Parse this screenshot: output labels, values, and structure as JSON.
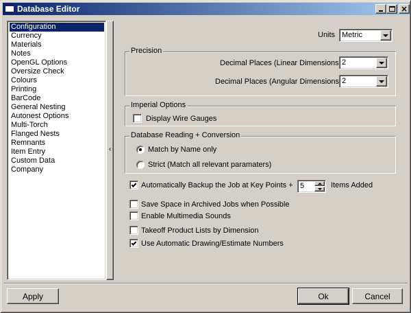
{
  "window": {
    "title": "Database Editor"
  },
  "nav": {
    "selected_index": 0,
    "items": [
      "Configuration",
      "Currency",
      "Materials",
      "Notes",
      "OpenGL Options",
      "Oversize Check",
      "Colours",
      "Printing",
      "BarCode",
      "General Nesting",
      "Autonest Options",
      "Multi-Torch",
      "Flanged Nests",
      "Remnants",
      "Item Entry",
      "Custom Data",
      "Company"
    ]
  },
  "units": {
    "label": "Units",
    "value": "Metric"
  },
  "precision": {
    "title": "Precision",
    "linear_label": "Decimal Places (Linear Dimensions)",
    "linear_value": "2",
    "angular_label": "Decimal Places (Angular Dimensions)",
    "angular_value": "2"
  },
  "imperial": {
    "title": "Imperial Options",
    "wire_gauges_label": "Display Wire Gauges",
    "wire_gauges_checked": false
  },
  "reading": {
    "title": "Database Reading + Conversion",
    "match_name_label": "Match by Name only",
    "strict_label": "Strict (Match all relevant paramaters)",
    "selected": "match_name"
  },
  "backup": {
    "label": "Automatically Backup the Job at Key Points +",
    "checked": true,
    "count": "5",
    "suffix": "Items Added"
  },
  "options": [
    {
      "label": "Save Space in Archived Jobs when Possible",
      "checked": false
    },
    {
      "label": "Enable Multimedia Sounds",
      "checked": false
    },
    {
      "label": "Takeoff Product Lists by Dimension",
      "checked": false
    },
    {
      "label": "Use Automatic Drawing/Estimate Numbers",
      "checked": true
    }
  ],
  "buttons": {
    "apply": "Apply",
    "ok": "Ok",
    "cancel": "Cancel"
  },
  "splitter": {
    "arrow": "‹"
  }
}
